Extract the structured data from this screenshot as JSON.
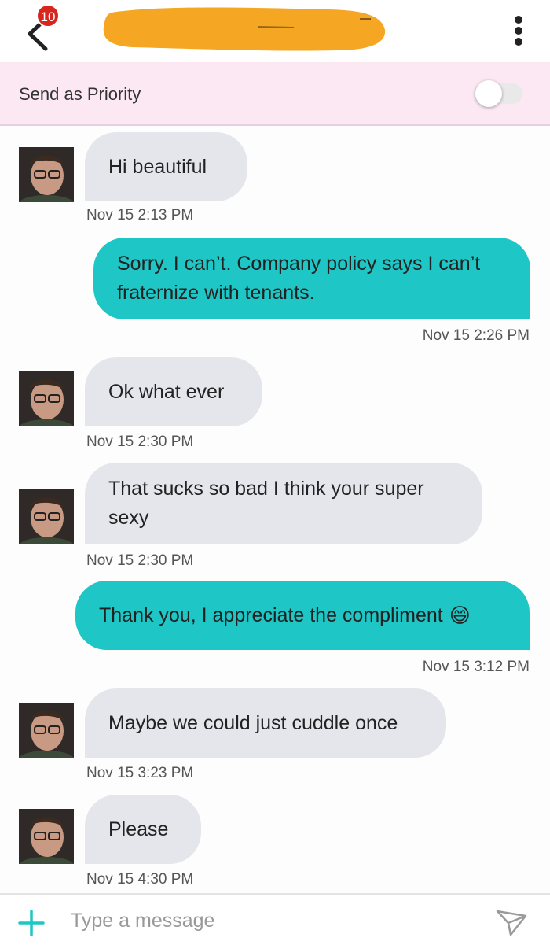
{
  "header": {
    "back_icon": "chevron-left-icon",
    "notification_count": "10",
    "menu_icon": "kebab-menu-icon"
  },
  "priority": {
    "label": "Send as Priority",
    "enabled": false
  },
  "messages": [
    {
      "direction": "incoming",
      "text": "Hi beautiful",
      "time": "Nov 15 2:13 PM"
    },
    {
      "direction": "outgoing",
      "text": "Sorry. I can’t. Company policy says I can’t fraternize with tenants.",
      "time": "Nov 15 2:26 PM"
    },
    {
      "direction": "incoming",
      "text": "Ok what ever",
      "time": "Nov 15 2:30 PM"
    },
    {
      "direction": "incoming",
      "text": "That sucks so bad I think your super sexy",
      "time": "Nov 15 2:30 PM"
    },
    {
      "direction": "outgoing",
      "text": "Thank you, I appreciate the compliment",
      "emoji": "😄",
      "time": "Nov 15 3:12 PM"
    },
    {
      "direction": "incoming",
      "text": "Maybe we could just cuddle once",
      "time": "Nov 15 3:23 PM"
    },
    {
      "direction": "incoming",
      "text": "Please",
      "time": "Nov 15 4:30 PM"
    }
  ],
  "composer": {
    "placeholder": "Type a message",
    "value": "",
    "add_icon": "plus-icon",
    "send_icon": "send-icon"
  },
  "colors": {
    "outgoing_bubble": "#1ec6c6",
    "incoming_bubble": "#e4e6eb",
    "priority_bar": "#fbe8f2",
    "badge": "#d7261e",
    "redaction": "#f5a623",
    "accent": "#1ec6c6"
  }
}
